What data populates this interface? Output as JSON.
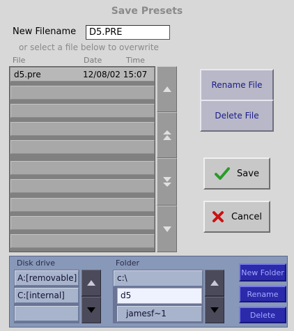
{
  "dialog": {
    "title": "Save Presets",
    "new_filename_label": "New Filename",
    "new_filename_value": "D5.PRE",
    "hint": "or select a file below to overwrite"
  },
  "file_list": {
    "columns": [
      "File",
      "Date",
      "Time"
    ],
    "rows": [
      {
        "file": "d5.pre",
        "datetime": "12/08/02 15:07"
      }
    ]
  },
  "buttons": {
    "rename_file": "Rename File",
    "delete_file": "Delete File",
    "save": "Save",
    "cancel": "Cancel"
  },
  "browser": {
    "disk_drive_label": "Disk drive",
    "drives": [
      "A:[removable]",
      "C:[internal]"
    ],
    "folder_label": "Folder",
    "folders": [
      "c:\\",
      "d5",
      "jamesf~1"
    ],
    "selected_folder": "d5",
    "new_folder": "New Folder",
    "rename": "Rename",
    "delete": "Delete"
  },
  "colors": {
    "panel_bg": "#d8d8d8",
    "accent_button_text": "#1a1a8a",
    "save_check": "#2a9a2a",
    "cancel_x": "#cc1111",
    "browser_bg": "#8898b8",
    "browser_button": "#2a2aaa"
  }
}
